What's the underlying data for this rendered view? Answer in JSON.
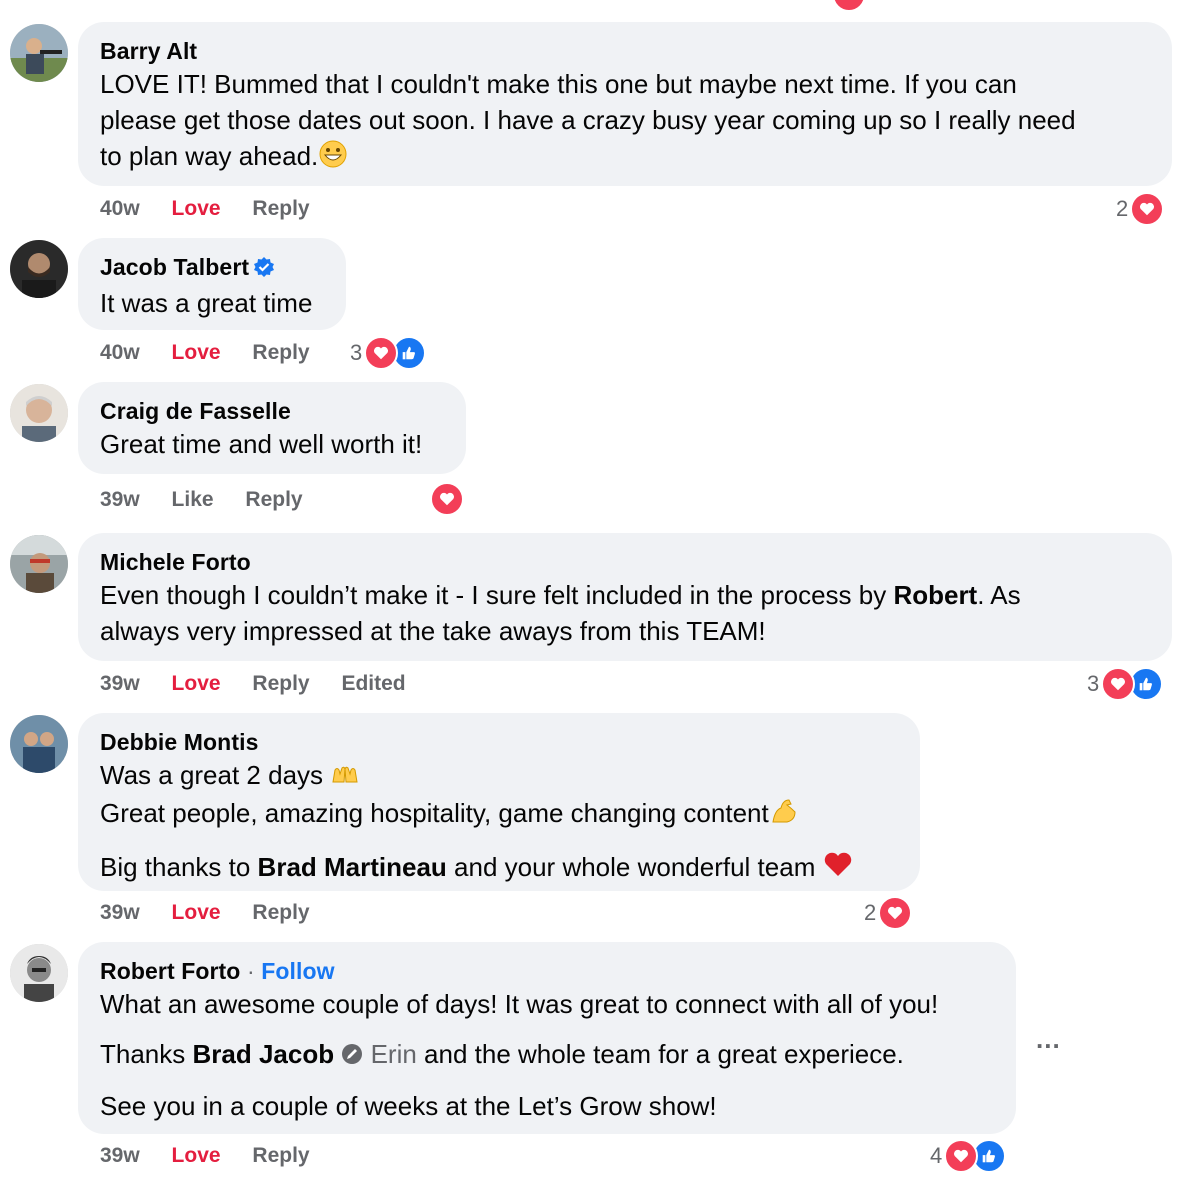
{
  "comments": [
    {
      "author": "Barry Alt",
      "lines": [
        "LOVE IT! Bummed that I couldn't make this one but maybe next time. If you can",
        "please get those dates out soon. I have a crazy busy year coming up so I really need",
        "to plan way ahead."
      ],
      "emoji": "grinning-face-icon",
      "time": "40w",
      "action1": "Love",
      "reply": "Reply",
      "reaction_count": "2"
    },
    {
      "author": "Jacob Talbert",
      "verified": true,
      "text": "It was a great time",
      "time": "40w",
      "action1": "Love",
      "reply": "Reply",
      "reaction_count": "3"
    },
    {
      "author": "Craig de Fasselle",
      "text": "Great time and well worth it!",
      "time": "39w",
      "action1": "Like",
      "reply": "Reply"
    },
    {
      "author": "Michele Forto",
      "line1_pre": "Even though I couldn’t make it - I sure felt included in the process by ",
      "line1_bold": "Robert",
      "line1_post": ". As",
      "line2": "always very impressed at the take aways from this TEAM!",
      "time": "39w",
      "action1": "Love",
      "reply": "Reply",
      "edited": "Edited",
      "reaction_count": "3"
    },
    {
      "author": "Debbie Montis",
      "line1": "Was a great 2 days",
      "line2": "Great people, amazing hospitality, game changing content",
      "line3_pre": "Big thanks to ",
      "line3_bold": "Brad Martineau",
      "line3_post": " and your whole wonderful team",
      "time": "39w",
      "action1": "Love",
      "reply": "Reply",
      "reaction_count": "2"
    },
    {
      "author": "Robert Forto",
      "follow": "Follow",
      "line1": "What an awesome couple of days! It was great to connect with all of you!",
      "line2_pre": "Thanks ",
      "line2_bold": "Brad Jacob",
      "line2_muted": "Erin",
      "line2_post": " and the whole team for a great experiece.",
      "line3": "See you in a couple of weeks at the Let’s Grow show!",
      "time": "39w",
      "action1": "Love",
      "reply": "Reply",
      "reaction_count": "4",
      "more": "..."
    }
  ],
  "colors": {
    "love": "#e41e3f",
    "link": "#1877f2",
    "bubble": "#f0f2f5",
    "heart": "#f33e58"
  }
}
